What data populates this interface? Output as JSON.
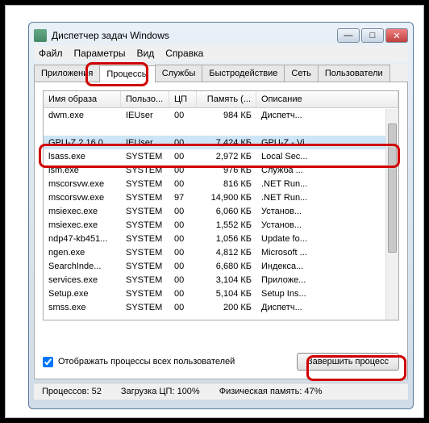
{
  "window": {
    "title": "Диспетчер задач Windows"
  },
  "menu": {
    "file": "Файл",
    "options": "Параметры",
    "view": "Вид",
    "help": "Справка"
  },
  "tabs": {
    "apps": "Приложения",
    "processes": "Процессы",
    "services": "Службы",
    "performance": "Быстродействие",
    "network": "Сеть",
    "users": "Пользователи"
  },
  "columns": {
    "image": "Имя образа",
    "user": "Пользо...",
    "cpu": "ЦП",
    "memory": "Память (...",
    "description": "Описание"
  },
  "rows": [
    {
      "img": "dwm.exe",
      "user": "IEUser",
      "cpu": "00",
      "mem": "984 КБ",
      "desc": "Диспетч..."
    },
    {
      "img": "",
      "user": "",
      "cpu": "",
      "mem": "",
      "desc": ""
    },
    {
      "img": "GPU-Z.2.16.0...",
      "user": "IEUser",
      "cpu": "00",
      "mem": "7,424 КБ",
      "desc": "GPU-Z - Vi...",
      "selected": true
    },
    {
      "img": "lsass.exe",
      "user": "SYSTEM",
      "cpu": "00",
      "mem": "2,972 КБ",
      "desc": "Local Sec..."
    },
    {
      "img": "lsm.exe",
      "user": "SYSTEM",
      "cpu": "00",
      "mem": "976 КБ",
      "desc": "Служба ..."
    },
    {
      "img": "mscorsvw.exe",
      "user": "SYSTEM",
      "cpu": "00",
      "mem": "816 КБ",
      "desc": ".NET Run..."
    },
    {
      "img": "mscorsvw.exe",
      "user": "SYSTEM",
      "cpu": "97",
      "mem": "14,900 КБ",
      "desc": ".NET Run..."
    },
    {
      "img": "msiexec.exe",
      "user": "SYSTEM",
      "cpu": "00",
      "mem": "6,060 КБ",
      "desc": "Установ..."
    },
    {
      "img": "msiexec.exe",
      "user": "SYSTEM",
      "cpu": "00",
      "mem": "1,552 КБ",
      "desc": "Установ..."
    },
    {
      "img": "ndp47-kb451...",
      "user": "SYSTEM",
      "cpu": "00",
      "mem": "1,056 КБ",
      "desc": "Update fo..."
    },
    {
      "img": "ngen.exe",
      "user": "SYSTEM",
      "cpu": "00",
      "mem": "4,812 КБ",
      "desc": "Microsoft ..."
    },
    {
      "img": "SearchInde...",
      "user": "SYSTEM",
      "cpu": "00",
      "mem": "6,680 КБ",
      "desc": "Индекса..."
    },
    {
      "img": "services.exe",
      "user": "SYSTEM",
      "cpu": "00",
      "mem": "3,104 КБ",
      "desc": "Приложе..."
    },
    {
      "img": "Setup.exe",
      "user": "SYSTEM",
      "cpu": "00",
      "mem": "5,104 КБ",
      "desc": "Setup Ins..."
    },
    {
      "img": "smss.exe",
      "user": "SYSTEM",
      "cpu": "00",
      "mem": "200 КБ",
      "desc": "Диспетч..."
    }
  ],
  "checkbox": {
    "label": "Отображать процессы всех пользователей"
  },
  "end_button": "Завершить процесс",
  "status": {
    "processes": "Процессов: 52",
    "cpu": "Загрузка ЦП: 100%",
    "memory": "Физическая память: 47%"
  }
}
